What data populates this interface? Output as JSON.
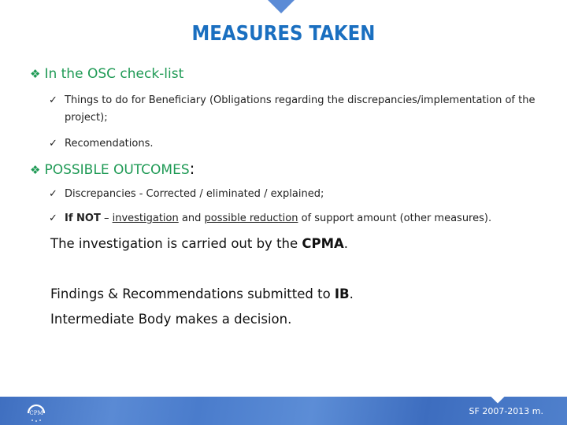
{
  "slide": {
    "title": "MEASURES TAKEN",
    "sections": [
      {
        "heading": "In the OSC check-list",
        "bullet_icon": "diamond-bullet-icon",
        "items": [
          {
            "text": "Things to do for Beneficiary (Obligations regarding the discrepancies/implementation of the",
            "continuation": "project);"
          },
          {
            "text": "Recomendations."
          }
        ]
      },
      {
        "heading": "POSSIBLE OUTCOMES",
        "heading_suffix": ":",
        "bullet_icon": "diamond-bullet-icon",
        "items": [
          {
            "text": "Discrepancies - Corrected / eliminated / explained;"
          },
          {
            "bold_prefix": "If NOT",
            "dash": " – ",
            "underlined_1": "investigation",
            "mid": " and ",
            "underlined_2": "possible reduction",
            "tail": " of support amount (other measures)."
          }
        ]
      }
    ],
    "paragraphs": [
      {
        "text": "The investigation is carried out by the ",
        "bold": "CPMA",
        "end": "."
      },
      {
        "text": "Findings & Recommendations submitted to ",
        "bold": "IB",
        "end": "."
      },
      {
        "text": "Intermediate Body makes a decision."
      }
    ],
    "check_glyph": "✓",
    "diamond_glyph": "❖"
  },
  "footer": {
    "logo_text": "CPM",
    "label": "SF 2007-2013 m.",
    "color": "#4a7ccc"
  },
  "colors": {
    "title": "#1a6fc0",
    "heading": "#1f9a55"
  }
}
